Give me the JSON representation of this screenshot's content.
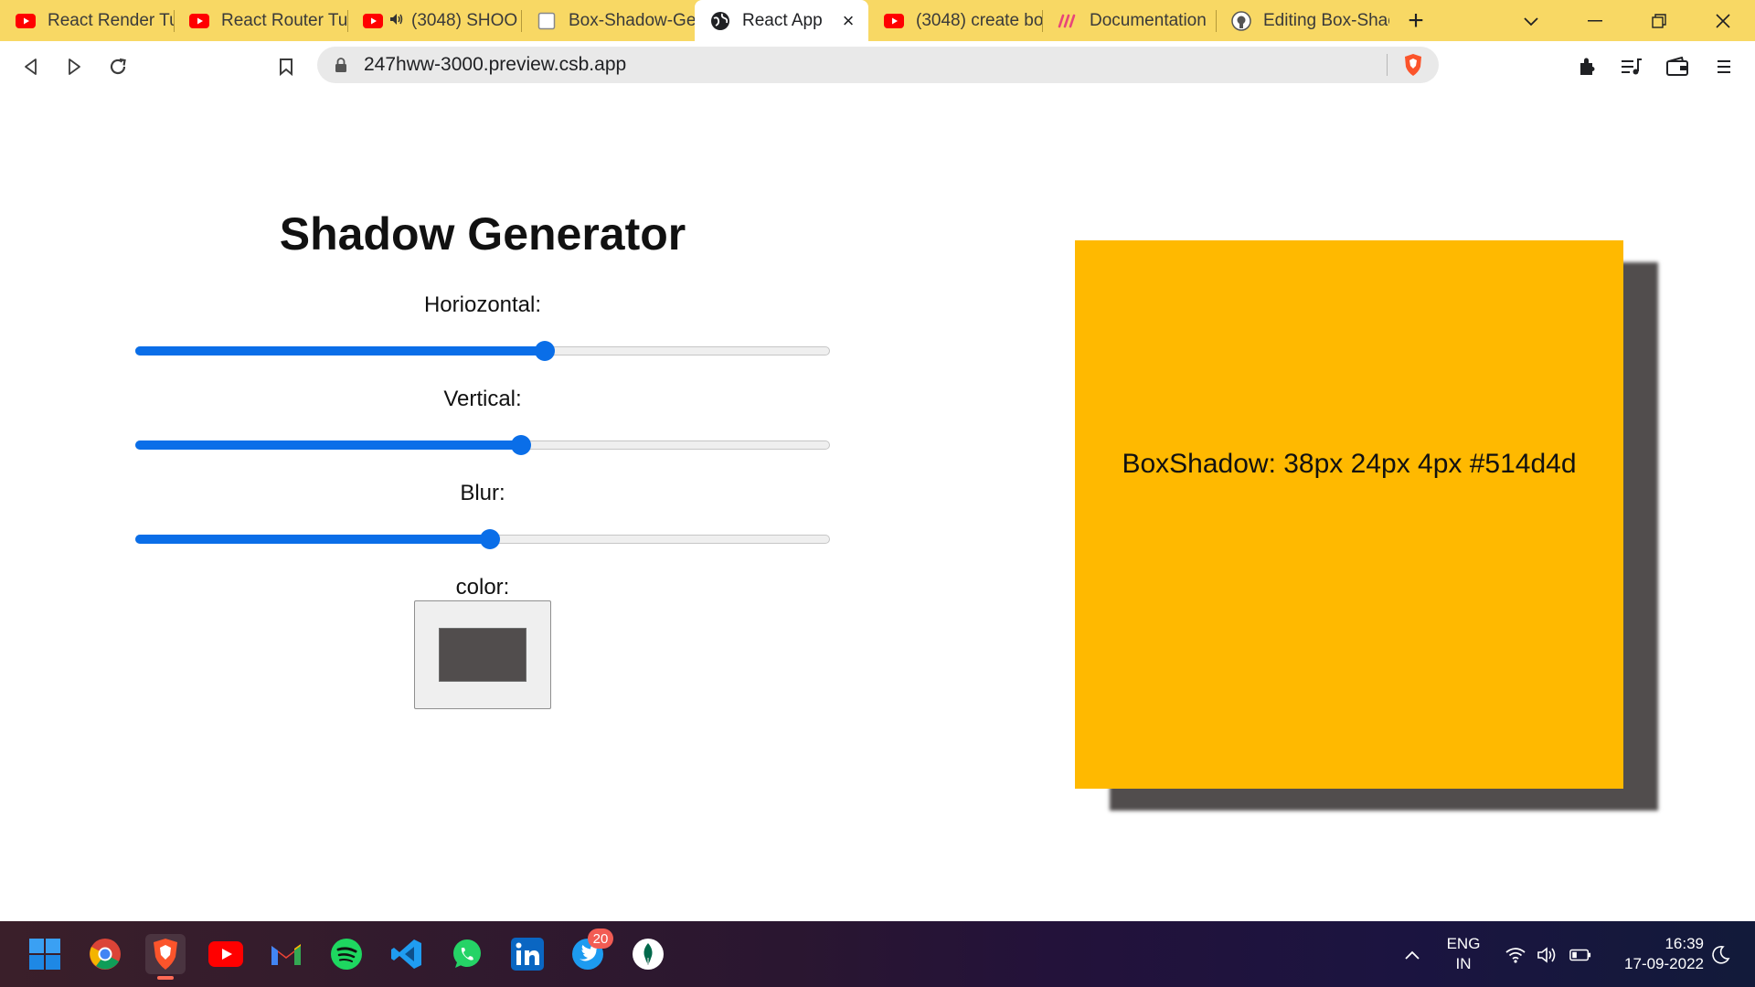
{
  "browser": {
    "tabs": [
      {
        "title": "React Render Tut",
        "icon": "youtube-icon"
      },
      {
        "title": "React Router Tut",
        "icon": "youtube-icon"
      },
      {
        "title": "(3048) SHOO",
        "icon": "youtube-icon",
        "audio": true
      },
      {
        "title": "Box-Shadow-Ge",
        "icon": "sandbox-icon"
      },
      {
        "title": "React App",
        "icon": "globe-icon",
        "active": true,
        "close": "×"
      },
      {
        "title": "(3048) create bo",
        "icon": "youtube-icon"
      },
      {
        "title": "Documentation",
        "icon": "docs-icon"
      },
      {
        "title": "Editing Box-Shac",
        "icon": "github-icon"
      }
    ],
    "new_tab_label": "+",
    "url": "247hww-3000.preview.csb.app"
  },
  "page": {
    "heading": "Shadow Generator",
    "controls": [
      {
        "label": "Horiozontal:",
        "value_fraction": 0.59
      },
      {
        "label": "Vertical:",
        "value_fraction": 0.555
      },
      {
        "label": "Blur:",
        "value_fraction": 0.51
      }
    ],
    "color_label": "color:",
    "color_value": "#514d4d",
    "preview": {
      "text": "BoxShadow: 38px 24px 4px #514d4d",
      "background": "#ffb900",
      "shadow": {
        "x": 38,
        "y": 24,
        "blur": 4,
        "color": "#514d4d"
      }
    }
  },
  "taskbar": {
    "apps": [
      "windows-start-icon",
      "chrome-icon",
      "brave-icon",
      "youtube-icon",
      "gmail-icon",
      "spotify-icon",
      "vscode-icon",
      "whatsapp-icon",
      "linkedin-icon",
      "twitter-icon",
      "mongodb-compass-icon"
    ],
    "twitter_badge": "20",
    "lang_line1": "ENG",
    "lang_line2": "IN",
    "time": "16:39",
    "date": "17-09-2022"
  },
  "colors": {
    "tab_strip": "#f8d864",
    "slider_accent": "#0a6ee8",
    "preview_bg": "#ffb900"
  }
}
